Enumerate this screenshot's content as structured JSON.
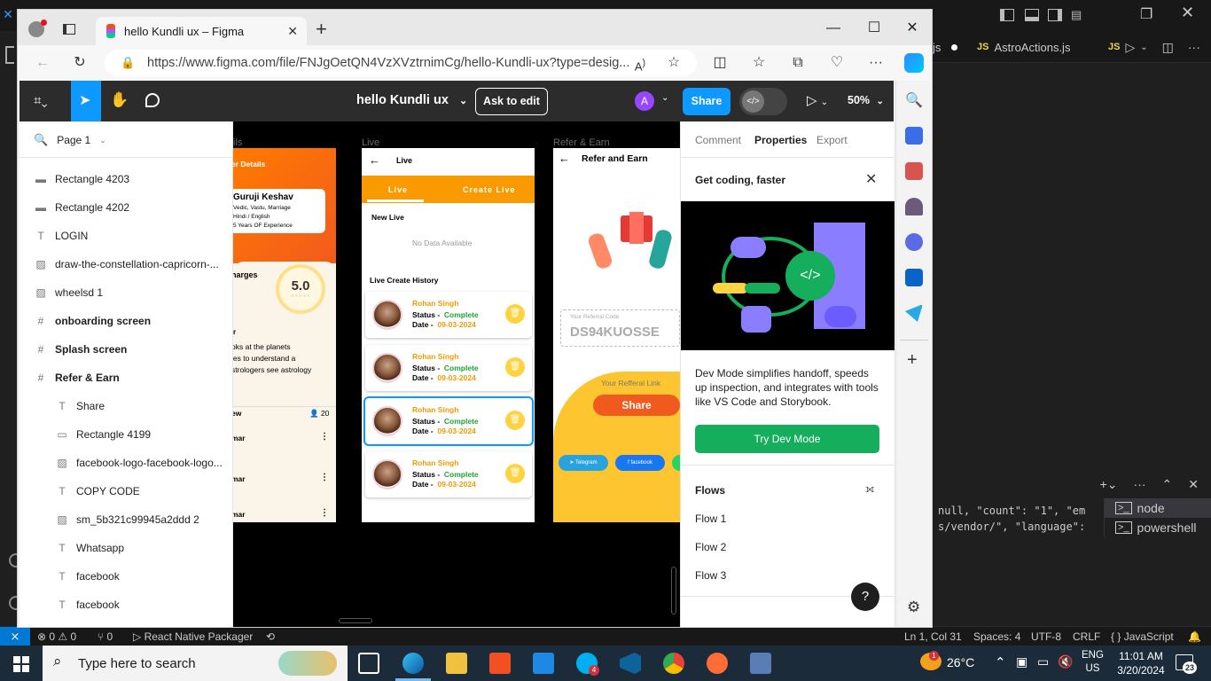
{
  "vscode": {
    "tabs": [
      {
        "label": "js",
        "icon": "js-file-icon"
      },
      {
        "label": "AstroActions.js",
        "icon": "js-file-icon"
      }
    ],
    "terminal": {
      "line1": "null, \"count\": \"1\", \"em",
      "line2": "s/vendor/\", \"language\":",
      "shells": [
        "node",
        "powershell"
      ]
    },
    "status": {
      "errors": "0",
      "warnings": "0",
      "ports": "0",
      "packager": "React Native Packager",
      "position": "Ln 1, Col 31",
      "spaces": "Spaces: 4",
      "encoding": "UTF-8",
      "eol": "CRLF",
      "language": "JavaScript"
    }
  },
  "edge": {
    "tab_title": "hello Kundli ux – Figma",
    "url": "https://www.figma.com/file/FNJgOetQN4VzXVztrnimCg/hello-Kundli-ux?type=desig..."
  },
  "figma": {
    "file_name": "hello Kundli ux",
    "ask_to_edit": "Ask to edit",
    "share": "Share",
    "avatar_initial": "A",
    "zoom": "50%",
    "page": "Page 1",
    "layers": [
      {
        "icon": "line-icon",
        "label": "Rectangle 4203",
        "indent": 0,
        "bold": false
      },
      {
        "icon": "line-icon",
        "label": "Rectangle 4202",
        "indent": 0,
        "bold": false
      },
      {
        "icon": "text-icon",
        "label": "LOGIN",
        "indent": 0,
        "bold": false
      },
      {
        "icon": "image-icon",
        "label": "draw-the-constellation-capricorn-...",
        "indent": 0,
        "bold": false
      },
      {
        "icon": "image-icon",
        "label": "wheelsd 1",
        "indent": 0,
        "bold": false
      },
      {
        "icon": "frame-icon",
        "label": "onboarding screen",
        "indent": 0,
        "bold": true
      },
      {
        "icon": "frame-icon",
        "label": "Splash screen",
        "indent": 0,
        "bold": true
      },
      {
        "icon": "frame-icon",
        "label": "Refer & Earn",
        "indent": 0,
        "bold": true
      },
      {
        "icon": "text-icon",
        "label": "Share",
        "indent": 1,
        "bold": false
      },
      {
        "icon": "rect-icon",
        "label": "Rectangle 4199",
        "indent": 1,
        "bold": false
      },
      {
        "icon": "image-icon",
        "label": "facebook-logo-facebook-logo...",
        "indent": 1,
        "bold": false
      },
      {
        "icon": "text-icon",
        "label": "COPY CODE",
        "indent": 1,
        "bold": false
      },
      {
        "icon": "image-icon",
        "label": "sm_5b321c99945a2ddd 2",
        "indent": 1,
        "bold": false
      },
      {
        "icon": "text-icon",
        "label": "Whatsapp",
        "indent": 1,
        "bold": false
      },
      {
        "icon": "text-icon",
        "label": "facebook",
        "indent": 1,
        "bold": false
      },
      {
        "icon": "text-icon",
        "label": "facebook",
        "indent": 1,
        "bold": false
      }
    ],
    "canvas": {
      "frame1": {
        "label": "ils",
        "header": "er Details",
        "name": "Guruji Keshav",
        "skills": "Vedic, Vastu, Marriage",
        "lang": "Hindi / English",
        "exp": "5 Years OF Experience",
        "charges": "harges",
        "rating": "5.0",
        "about_r": "r",
        "about1": "oks at the planets",
        "about2": "ies to understand a",
        "about3": "strologers see astrology",
        "reviews": "ew",
        "review_count": "20",
        "rev1": "mar",
        "rev2": "mar",
        "rev3": "mar"
      },
      "frame2": {
        "label": "Live",
        "title": "Live",
        "tab_live": "Live",
        "tab_create": "Create Live",
        "new_live": "New Live",
        "no_data": "No Data Available",
        "history": "Live Create History",
        "cards": [
          {
            "name": "Rohan Singh",
            "status_label": "Status -",
            "status": "Complete",
            "date_label": "Date -",
            "date": "09-03-2024"
          },
          {
            "name": "Rohan Singh",
            "status_label": "Status -",
            "status": "Complete",
            "date_label": "Date -",
            "date": "09-03-2024"
          },
          {
            "name": "Rohan Singh",
            "status_label": "Status -",
            "status": "Complete",
            "date_label": "Date -",
            "date": "09-03-2024"
          },
          {
            "name": "Rohan Singh",
            "status_label": "Status -",
            "status": "Complete",
            "date_label": "Date -",
            "date": "09-03-2024"
          }
        ]
      },
      "frame3": {
        "label": "Refer & Earn",
        "title": "Refer and Earn",
        "code_label": "Your Referral Code",
        "code": "DS94KUOSSE",
        "link_label": "Your Refferal Link",
        "share": "Share",
        "telegram": "Telegram",
        "facebook": "facebook"
      }
    },
    "right_panel": {
      "tabs": [
        "Comment",
        "Properties",
        "Export"
      ],
      "promo_title": "Get coding, faster",
      "promo_text": "Dev Mode simplifies handoff, speeds up inspection, and integrates with tools like VS Code and Storybook.",
      "promo_button": "Try Dev Mode",
      "flows_title": "Flows",
      "flows": [
        "Flow 1",
        "Flow 2",
        "Flow 3"
      ],
      "help": "?"
    }
  },
  "taskbar": {
    "search_placeholder": "Type here to search",
    "weather": "26°C",
    "weather_badge": "1",
    "lang1": "ENG",
    "lang2": "US",
    "time": "11:01 AM",
    "date": "3/20/2024",
    "notif": "23",
    "skype_badge": "4"
  },
  "colors": {
    "figma_blue": "#0d99ff",
    "orange": "#f29a00",
    "dev_green": "#14ae5c",
    "vscode_blue": "#0078d4"
  }
}
